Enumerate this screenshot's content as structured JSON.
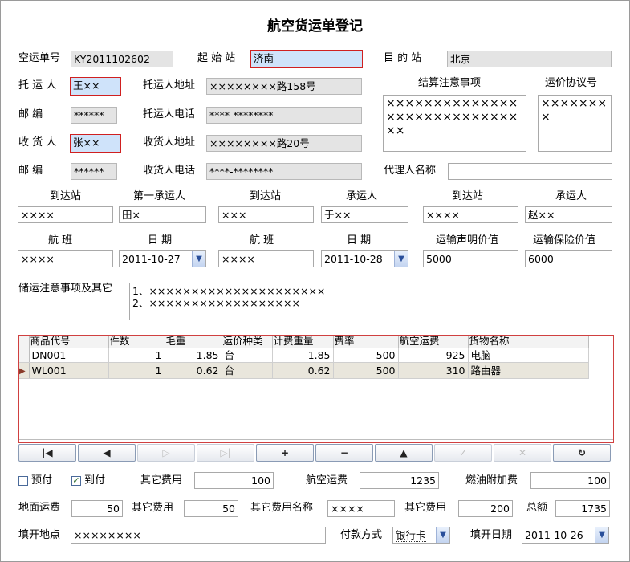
{
  "title": "航空货运单登记",
  "waybill": {
    "no_label": "空运单号",
    "no_value": "KY2011102602",
    "origin_label": "起 始 站",
    "origin_value": "济南",
    "dest_label": "目 的 站",
    "dest_value": "北京"
  },
  "shipper": {
    "name_label": "托 运 人",
    "name_value": "王××",
    "addr_label": "托运人地址",
    "addr_value": "××××××××路158号",
    "zip_label": "邮    编",
    "zip_value": "******",
    "phone_label": "托运人电话",
    "phone_value": "****-********"
  },
  "consignee": {
    "name_label": "收 货 人",
    "name_value": "张××",
    "addr_label": "收货人地址",
    "addr_value": "××××××××路20号",
    "zip_label": "邮    编",
    "zip_value": "******",
    "phone_label": "收货人电话",
    "phone_value": "****-********"
  },
  "settlement": {
    "label": "结算注意事项",
    "value": "××××××××××××××××××××××××××××××",
    "tariff_label": "运价协议号",
    "tariff_value": "××××××××"
  },
  "agent": {
    "label": "代理人名称",
    "value": ""
  },
  "routing": {
    "headers": [
      "到达站",
      "第一承运人",
      "到达站",
      "承运人",
      "到达站",
      "承运人"
    ],
    "values": [
      "××××",
      "田×",
      "×××",
      "于××",
      "××××",
      "赵××"
    ]
  },
  "flights": {
    "headers": [
      "航  班",
      "日  期",
      "航  班",
      "日  期",
      "运输声明价值",
      "运输保险价值"
    ],
    "flight1": "××××",
    "date1": "2011-10-27",
    "flight2": "××××",
    "date2": "2011-10-28",
    "declared": "5000",
    "insured": "6000"
  },
  "storage": {
    "label": "储运注意事项及其它",
    "line1": "1、×××××××××××××××××××××",
    "line2": "2、××××××××××××××××××"
  },
  "grid": {
    "columns": [
      "商品代号",
      "件数",
      "毛重",
      "运价种类",
      "计费重量",
      "费率",
      "航空运费",
      "货物名称"
    ],
    "rows": [
      [
        "DN001",
        "1",
        "1.85",
        "台",
        "1.85",
        "500",
        "925",
        "电脑"
      ],
      [
        "WL001",
        "1",
        "0.62",
        "台",
        "0.62",
        "500",
        "310",
        "路由器"
      ]
    ]
  },
  "nav": {
    "first": "|◀",
    "prev": "◀",
    "next": "▷",
    "last": "▷|",
    "add": "+",
    "delete": "−",
    "up": "▲",
    "post": "✓",
    "cancel": "✕",
    "refresh": "↻"
  },
  "fees": {
    "prepaid_label": "预付",
    "prepaid_checked": false,
    "collect_label": "到付",
    "collect_checked": true,
    "other1_label": "其它费用",
    "other1_value": "100",
    "air_label": "航空运费",
    "air_value": "1235",
    "fuel_label": "燃油附加费",
    "fuel_value": "100",
    "ground_label": "地面运费",
    "ground_value": "50",
    "other2_label": "其它费用",
    "other2_value": "50",
    "othername_label": "其它费用名称",
    "othername_value": "××××",
    "other3_label": "其它费用",
    "other3_value": "200",
    "total_label": "总额",
    "total_value": "1735"
  },
  "footer": {
    "place_label": "填开地点",
    "place_value": "××××××××",
    "pay_label": "付款方式",
    "pay_value": "银行卡",
    "date_label": "填开日期",
    "date_value": "2011-10-26"
  }
}
